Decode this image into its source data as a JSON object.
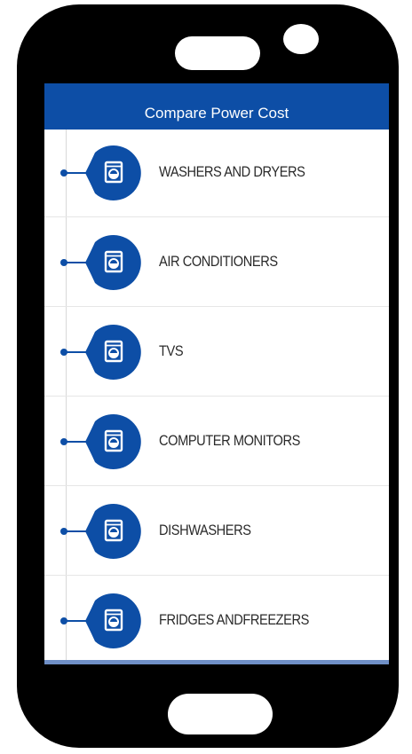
{
  "app": {
    "title": "Compare Power Cost"
  },
  "colors": {
    "brand": "#0d4ea6",
    "device": "#000000"
  },
  "categories": [
    {
      "label": "WASHERS AND DRYERS",
      "icon": "washer-icon"
    },
    {
      "label": "AIR CONDITIONERS",
      "icon": "washer-icon"
    },
    {
      "label": "TVS",
      "icon": "washer-icon"
    },
    {
      "label": "COMPUTER MONITORS",
      "icon": "washer-icon"
    },
    {
      "label": "DISHWASHERS",
      "icon": "washer-icon"
    },
    {
      "label": "FRIDGES ANDFREEZERS",
      "icon": "washer-icon"
    }
  ]
}
